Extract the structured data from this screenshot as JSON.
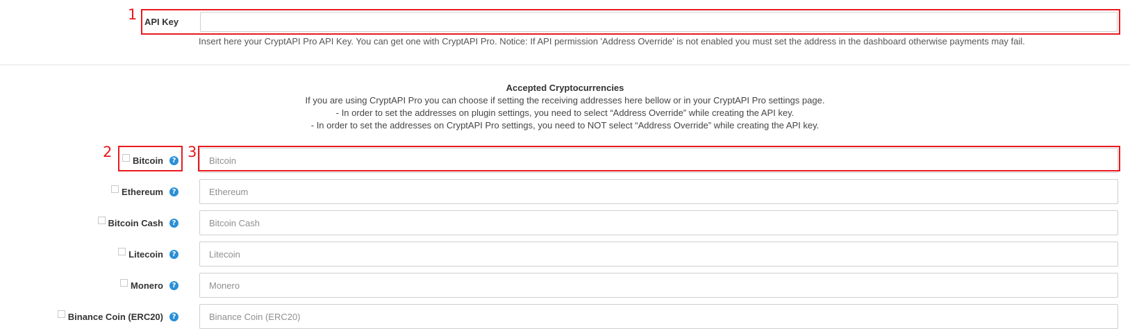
{
  "annotations": {
    "one": "1",
    "two": "2",
    "three": "3"
  },
  "api_key": {
    "label": "API Key",
    "value": "",
    "help": "Insert here your CryptAPI Pro API Key. You can get one with CryptAPI Pro. Notice: If API permission 'Address Override' is not enabled you must set the address in the dashboard otherwise payments may fail."
  },
  "intro": {
    "heading": "Accepted Cryptocurrencies",
    "line1": "If you are using CryptAPI Pro you can choose if setting the receiving addresses here bellow or in your CryptAPI Pro settings page.",
    "line2": "- In order to set the addresses on plugin settings, you need to select “Address Override” while creating the API key.",
    "line3": "- In order to set the addresses on CryptAPI Pro settings, you need to NOT select “Address Override” while creating the API key."
  },
  "coins": [
    {
      "label": "Bitcoin",
      "placeholder": "Bitcoin",
      "checked": false
    },
    {
      "label": "Ethereum",
      "placeholder": "Ethereum",
      "checked": false
    },
    {
      "label": "Bitcoin Cash",
      "placeholder": "Bitcoin Cash",
      "checked": false
    },
    {
      "label": "Litecoin",
      "placeholder": "Litecoin",
      "checked": false
    },
    {
      "label": "Monero",
      "placeholder": "Monero",
      "checked": false
    },
    {
      "label": "Binance Coin (ERC20)",
      "placeholder": "Binance Coin (ERC20)",
      "checked": false
    }
  ],
  "icons": {
    "help": "?",
    "help_name": "question-circle-icon"
  },
  "colors": {
    "annotation_red": "#e8191f",
    "help_blue": "#2a8fd6"
  }
}
